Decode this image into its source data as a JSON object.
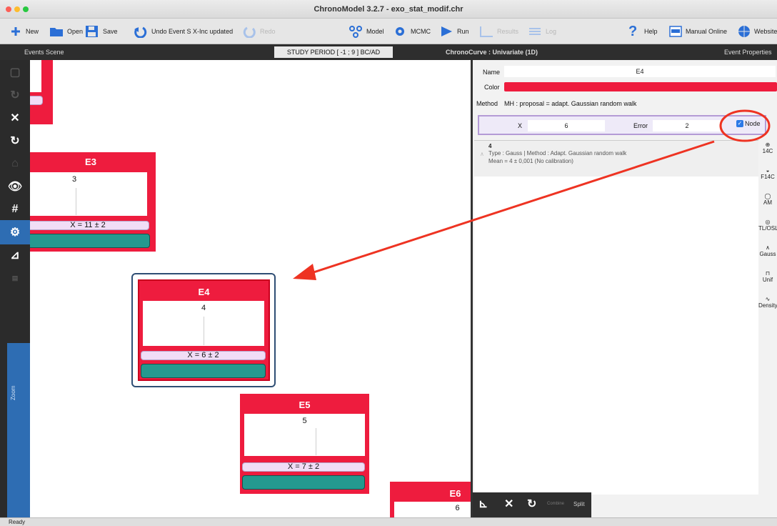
{
  "window": {
    "title": "ChronoModel 3.2.7 - exo_stat_modif.chr"
  },
  "toolbar": {
    "new": "New",
    "open": "Open",
    "save": "Save",
    "undo": "Undo Event S X-Inc updated",
    "redo": "Redo",
    "model": "Model",
    "mcmc": "MCMC",
    "run": "Run",
    "results": "Results",
    "log": "Log",
    "help": "Help",
    "manual": "Manual Online",
    "website": "Website"
  },
  "sections": {
    "events_scene": "Events Scene",
    "study_period": "STUDY PERIOD [ -1 ; 9 ] BC/AD",
    "chronocurve": "ChronoCurve : Univariate (1D)",
    "event_properties": "Event Properties"
  },
  "events": [
    {
      "name": "E3",
      "value": "3",
      "x_label": "X = 11 ± 2"
    },
    {
      "name": "E4",
      "value": "4",
      "x_label": "X = 6 ± 2"
    },
    {
      "name": "E5",
      "value": "5",
      "x_label": "X = 7 ± 2"
    },
    {
      "name": "E6",
      "value": "6"
    }
  ],
  "properties": {
    "name_label": "Name",
    "name_value": "E4",
    "color_label": "Color",
    "color_value": "#ee1c3e",
    "method_label": "Method",
    "method_value": "MH : proposal = adapt. Gaussian random walk",
    "x_label": "X",
    "x_value": "6",
    "error_label": "Error",
    "error_value": "2",
    "node_label": "Node",
    "node_checked": true,
    "date": {
      "id": "4",
      "line1": "Type : Gauss | Method : Adapt. Gaussian random walk",
      "line2": "Mean = 4 ± 0,001 (No calibration)"
    }
  },
  "dock": [
    "14C",
    "F14C",
    "AM",
    "TL/OSL",
    "Gauss",
    "Unif",
    "Density"
  ],
  "bottom": {
    "combine": "Combine",
    "split": "Split"
  },
  "status": "Ready",
  "colors": {
    "event_red": "#ee1c3e",
    "teal": "#24998f",
    "annotation": "#ee3322",
    "node_checkbox": "#2c79e6"
  }
}
